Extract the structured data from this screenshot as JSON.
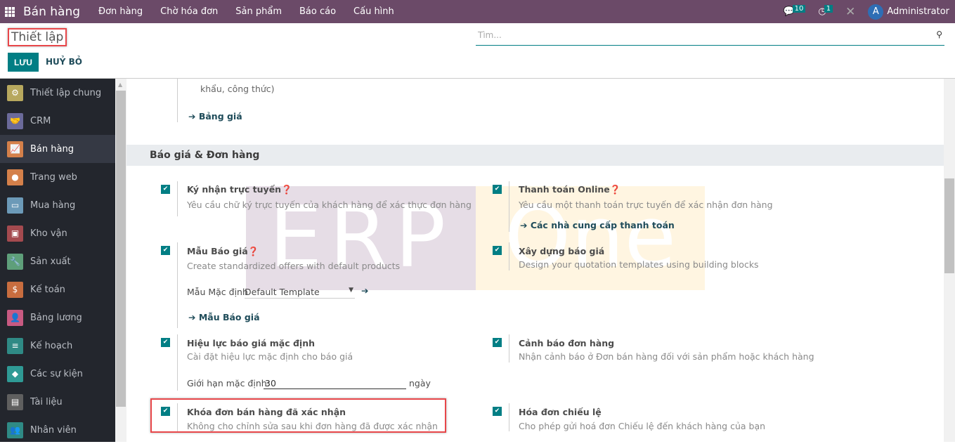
{
  "topbar": {
    "app": "Bán hàng",
    "menus": [
      "Đơn hàng",
      "Chờ hóa đơn",
      "Sản phẩm",
      "Báo cáo",
      "Cấu hình"
    ],
    "messages_count": "10",
    "activities_count": "1",
    "user_initial": "A",
    "user": "Administrator"
  },
  "control": {
    "title": "Thiết lập",
    "search_placeholder": "Tìm...",
    "save": "LƯU",
    "cancel": "HUỶ BỎ"
  },
  "sidebar": [
    {
      "label": "Thiết lập chung",
      "color": "#b7a85e",
      "icon": "⚙"
    },
    {
      "label": "CRM",
      "color": "#6b6a9a",
      "icon": "🤝"
    },
    {
      "label": "Bán hàng",
      "color": "#d4804a",
      "icon": "📈",
      "active": true
    },
    {
      "label": "Trang web",
      "color": "#d4804a",
      "icon": "●"
    },
    {
      "label": "Mua hàng",
      "color": "#6c9ab8",
      "icon": "▭"
    },
    {
      "label": "Kho vận",
      "color": "#a44a4f",
      "icon": "▣"
    },
    {
      "label": "Sản xuất",
      "color": "#5e9f7a",
      "icon": "🔧"
    },
    {
      "label": "Kế toán",
      "color": "#c86d3f",
      "icon": "$"
    },
    {
      "label": "Bảng lương",
      "color": "#c85a82",
      "icon": "👤"
    },
    {
      "label": "Kế hoạch",
      "color": "#2f8a85",
      "icon": "≡"
    },
    {
      "label": "Các sự kiện",
      "color": "#2f9a95",
      "icon": "◆"
    },
    {
      "label": "Tài liệu",
      "color": "#5f5f5f",
      "icon": "▤"
    },
    {
      "label": "Nhân viên",
      "color": "#2f8a85",
      "icon": "👥"
    }
  ],
  "content": {
    "prev_desc": "khẩu, công thức)",
    "prev_link": "Bảng giá",
    "section": "Báo giá & Đơn hàng",
    "settings": [
      {
        "label": "Ký nhận trực tuyến",
        "desc": "Yêu cầu chữ ký trực tuyến của khách hàng để xác thực đơn hàng"
      },
      {
        "label": "Thanh toán Online",
        "desc": "Yêu cầu một thanh toán trực tuyến để xác nhận đơn hàng",
        "link": "Các nhà cung cấp thanh toán"
      },
      {
        "label": "Mẫu Báo giá",
        "desc": "Create standardized offers with default products",
        "field_label": "Mẫu Mặc định",
        "field_value": "Default Template",
        "link": "Mẫu Báo giá"
      },
      {
        "label": "Xây dựng báo giá",
        "desc": "Design your quotation templates using building blocks"
      },
      {
        "label": "Hiệu lực báo giá mặc định",
        "desc": "Cài đặt hiệu lực mặc định cho báo giá",
        "field_label": "Giới hạn mặc định:",
        "field_value": "30",
        "unit": "ngày"
      },
      {
        "label": "Cảnh báo đơn hàng",
        "desc": "Nhận cảnh báo ở Đơn bán hàng đối với sản phẩm hoặc khách hàng"
      },
      {
        "label": "Khóa đơn bán hàng đã xác nhận",
        "desc": "Không cho chỉnh sửa sau khi đơn hàng đã được xác nhận"
      },
      {
        "label": "Hóa đơn chiếu lệ",
        "desc": "Cho phép gửi hoá đơn Chiếu lệ đến khách hàng của bạn"
      }
    ]
  },
  "watermark": {
    "left": "ERP",
    "right": "One"
  }
}
